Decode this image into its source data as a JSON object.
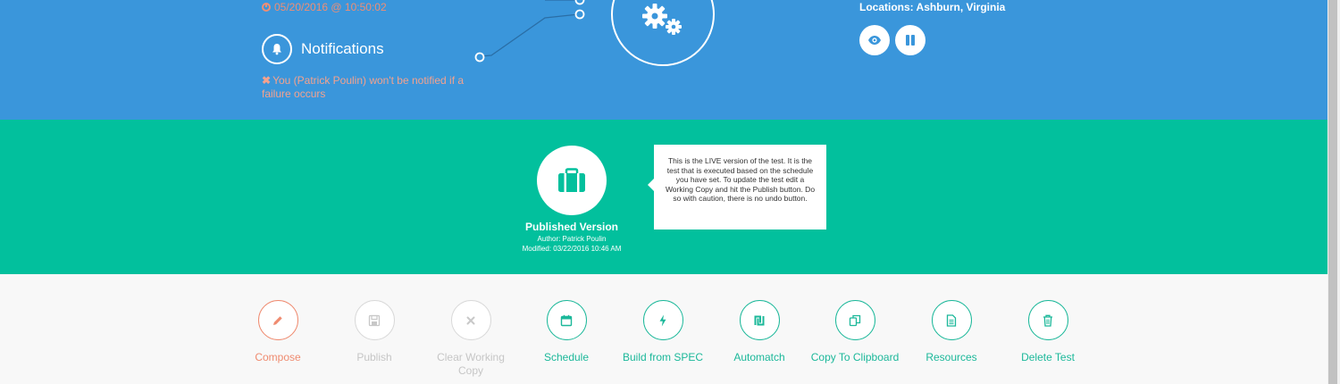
{
  "header": {
    "last_run": "05/20/2016 @ 10:50:02",
    "notifications_title": "Notifications",
    "notification_warning": "You (Patrick Poulin) won't be notified if a failure occurs",
    "locations": "Locations: Ashburn, Virginia",
    "icons": {
      "clock": "clock-icon",
      "bell": "bell-icon",
      "gears": "gears-icon",
      "eye": "eye-icon",
      "pause": "pause-icon"
    }
  },
  "published": {
    "title": "Published Version",
    "author": "Author: Patrick Poulin",
    "modified": "Modified: 03/22/2016 10:46 AM",
    "tooltip": "This is the LIVE version of the test. It is the test that is executed based on the schedule you have set. To update the test edit a Working Copy and hit the Publish button. Do so with caution, there is no undo button.",
    "icon": "briefcase-icon"
  },
  "actions": [
    {
      "label": "Compose",
      "icon": "pencil-icon",
      "state": "accent"
    },
    {
      "label": "Publish",
      "icon": "save-icon",
      "state": "disabled"
    },
    {
      "label": "Clear Working Copy",
      "icon": "close-icon",
      "state": "disabled"
    },
    {
      "label": "Schedule",
      "icon": "calendar-icon",
      "state": "normal"
    },
    {
      "label": "Build from SPEC",
      "icon": "bolt-icon",
      "state": "normal"
    },
    {
      "label": "Automatch",
      "icon": "automatch-icon",
      "state": "normal"
    },
    {
      "label": "Copy To Clipboard",
      "icon": "copy-icon",
      "state": "normal"
    },
    {
      "label": "Resources",
      "icon": "document-icon",
      "state": "normal"
    },
    {
      "label": "Delete Test",
      "icon": "trash-icon",
      "state": "normal"
    }
  ],
  "colors": {
    "header_blue": "#3a96db",
    "band_green": "#02c09d",
    "accent_orange": "#ef8b70",
    "action_teal": "#1cb89a",
    "disabled_gray": "#c6c6c6"
  }
}
